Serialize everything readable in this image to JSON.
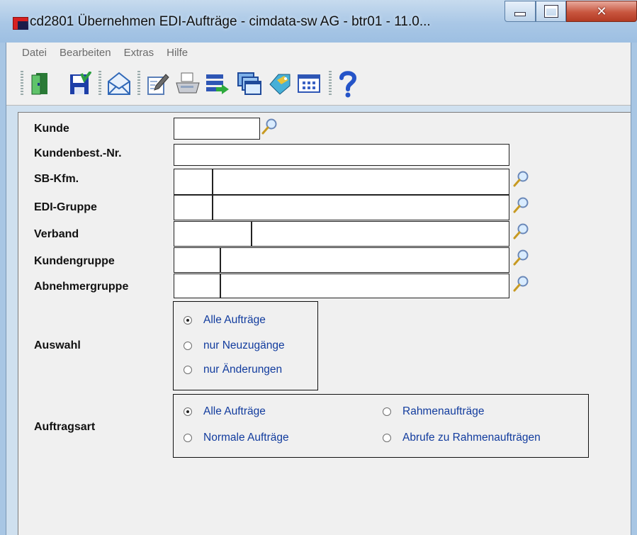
{
  "window": {
    "title": "cd2801 Übernehmen EDI-Aufträge - cimdata-sw AG - btr01 - 11.0..."
  },
  "menu": [
    "Datei",
    "Bearbeiten",
    "Extras",
    "Hilfe"
  ],
  "toolbar": {
    "icons": [
      "exit-door-icon",
      "save-icon",
      "mail-icon",
      "edit-icon",
      "print-icon",
      "list-transfer-icon",
      "windows-icon",
      "tag-icon",
      "grid-icon",
      "help-icon"
    ]
  },
  "form": {
    "kunde": {
      "label": "Kunde",
      "value": ""
    },
    "kundenbest": {
      "label": "Kundenbest.-Nr.",
      "value": ""
    },
    "sbkfm": {
      "label": "SB-Kfm.",
      "value": ""
    },
    "edigruppe": {
      "label": "EDI-Gruppe",
      "value": ""
    },
    "verband": {
      "label": "Verband",
      "value": ""
    },
    "kundengruppe": {
      "label": "Kundengruppe",
      "value": ""
    },
    "abnehmergruppe": {
      "label": "Abnehmergruppe",
      "value": ""
    }
  },
  "auswahl": {
    "label": "Auswahl",
    "options": [
      "Alle Aufträge",
      "nur Neuzugänge",
      "nur Änderungen"
    ],
    "selected": "Alle Aufträge"
  },
  "auftragsart": {
    "label": "Auftragsart",
    "options": [
      "Alle Aufträge",
      "Normale Aufträge",
      "Rahmenaufträge",
      "Abrufe zu Rahmenaufträgen"
    ],
    "selected": "Alle Aufträge"
  },
  "colors": {
    "option_text": "#123c9e",
    "title_bar": "#a9c7e6",
    "close_button": "#c8563f"
  }
}
